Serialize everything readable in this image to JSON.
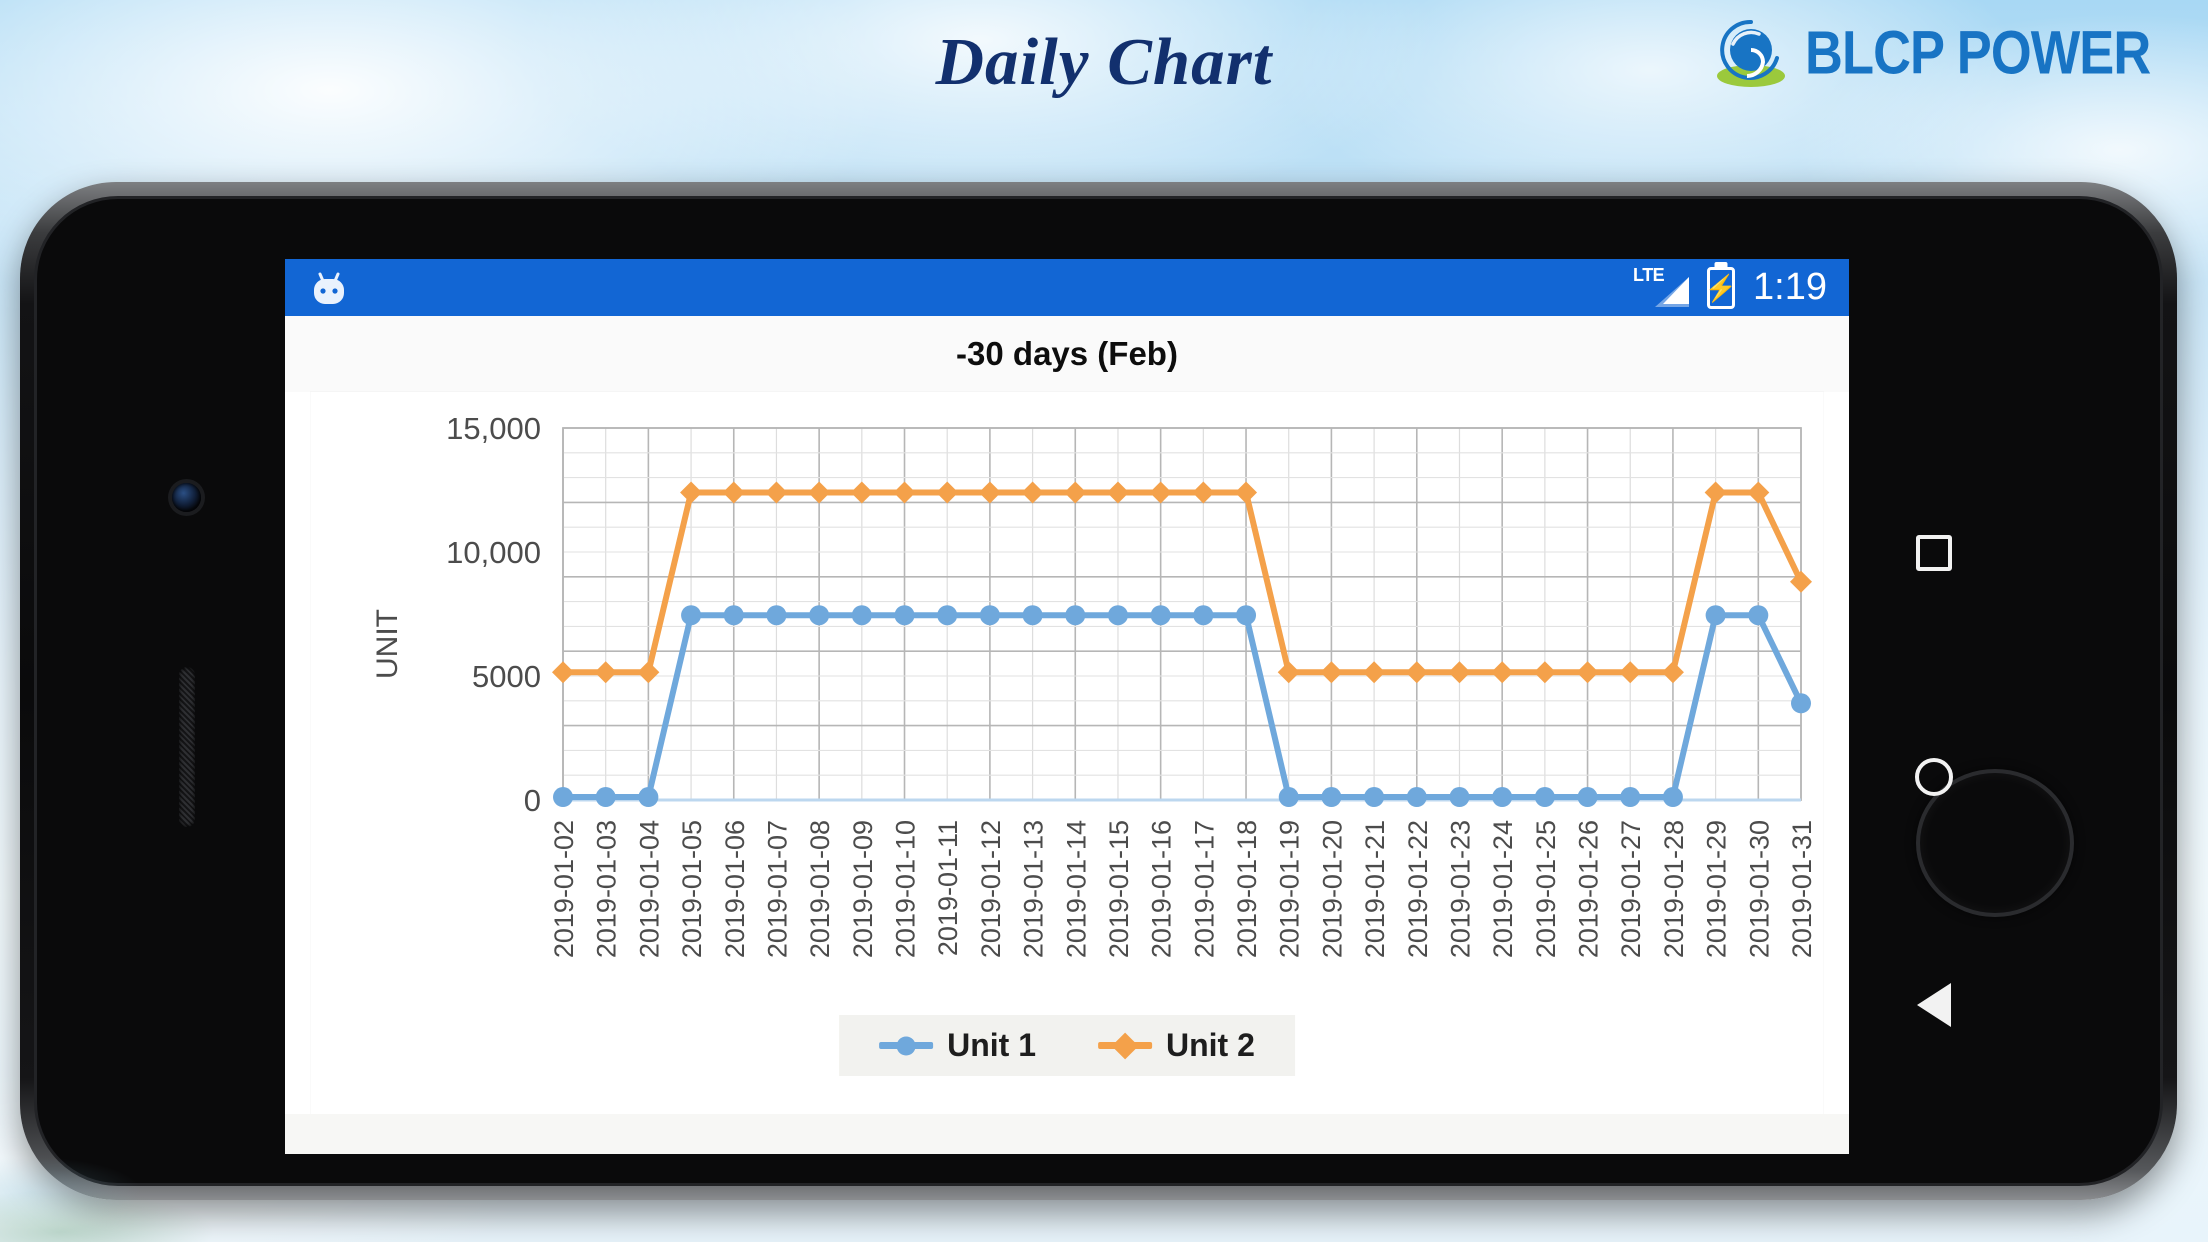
{
  "header": {
    "title": "Daily Chart",
    "logo_text": "BLCP POWER",
    "logo_icon": "blcp-swirl-logo",
    "brand_blue": "#1874c4",
    "brand_green": "#9bc93c",
    "title_color": "#12306e"
  },
  "device": {
    "navbar": {
      "recents_label": "Recents",
      "home_label": "Home",
      "back_label": "Back",
      "recents_icon": "square-icon",
      "home_icon": "circle-icon",
      "back_icon": "triangle-left-icon"
    },
    "bezel": {
      "camera_icon": "front-camera-icon",
      "speaker_icon": "earpiece-speaker-icon",
      "home_button_icon": "home-button-ring-icon"
    }
  },
  "statusbar": {
    "app_icon": "android-robot-icon",
    "network_label": "LTE",
    "signal_icon": "signal-bars-icon",
    "battery_icon": "battery-charging-icon",
    "time": "1:19",
    "background": "#1266d4"
  },
  "chart_data": {
    "type": "line",
    "title": "-30 days (Feb)",
    "xlabel": "",
    "ylabel": "UNIT",
    "ylim": [
      0,
      15000
    ],
    "yticks": [
      0,
      5000,
      10000,
      15000
    ],
    "ytick_labels": [
      "0",
      "5000",
      "10,000",
      "15,000"
    ],
    "grid": true,
    "legend_position": "bottom",
    "colors": {
      "unit1": "#6fa8dc",
      "unit2": "#f4a14a"
    },
    "markers": {
      "unit1": "circle",
      "unit2": "diamond"
    },
    "categories": [
      "2019-01-02",
      "2019-01-03",
      "2019-01-04",
      "2019-01-05",
      "2019-01-06",
      "2019-01-07",
      "2019-01-08",
      "2019-01-09",
      "2019-01-10",
      "2019-01-11",
      "2019-01-12",
      "2019-01-13",
      "2019-01-14",
      "2019-01-15",
      "2019-01-16",
      "2019-01-17",
      "2019-01-18",
      "2019-01-19",
      "2019-01-20",
      "2019-01-21",
      "2019-01-22",
      "2019-01-23",
      "2019-01-24",
      "2019-01-25",
      "2019-01-26",
      "2019-01-27",
      "2019-01-28",
      "2019-01-29",
      "2019-01-30",
      "2019-01-31"
    ],
    "series": [
      {
        "name": "Unit 1",
        "color": "#6fa8dc",
        "marker": "circle",
        "values": [
          120,
          120,
          120,
          7450,
          7450,
          7450,
          7450,
          7450,
          7450,
          7450,
          7450,
          7450,
          7450,
          7450,
          7450,
          7450,
          7450,
          120,
          120,
          120,
          120,
          120,
          120,
          120,
          120,
          120,
          120,
          7450,
          7450,
          3900
        ]
      },
      {
        "name": "Unit 2",
        "color": "#f4a14a",
        "marker": "diamond",
        "values": [
          5150,
          5150,
          5150,
          12400,
          12400,
          12400,
          12400,
          12400,
          12400,
          12400,
          12400,
          12400,
          12400,
          12400,
          12400,
          12400,
          12400,
          5150,
          5150,
          5150,
          5150,
          5150,
          5150,
          5150,
          5150,
          5150,
          5150,
          12400,
          12400,
          8800
        ]
      }
    ]
  },
  "legend": {
    "items": [
      {
        "label": "Unit 1",
        "color": "#6fa8dc",
        "marker": "circle"
      },
      {
        "label": "Unit 2",
        "color": "#f4a14a",
        "marker": "diamond"
      }
    ]
  }
}
